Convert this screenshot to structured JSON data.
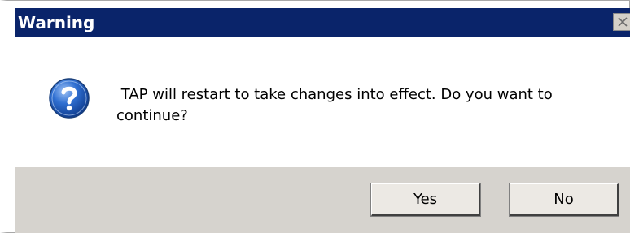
{
  "window": {
    "title": "Warning"
  },
  "message": {
    "text": " TAP will restart to take changes into effect. Do you want to\ncontinue?"
  },
  "icons": {
    "status_icon": "question-icon",
    "close_icon": "close-icon"
  },
  "buttons": {
    "yes_label": "Yes",
    "no_label": "No"
  },
  "colors": {
    "titlebar": "#0a246a",
    "footer": "#d6d3ce"
  }
}
